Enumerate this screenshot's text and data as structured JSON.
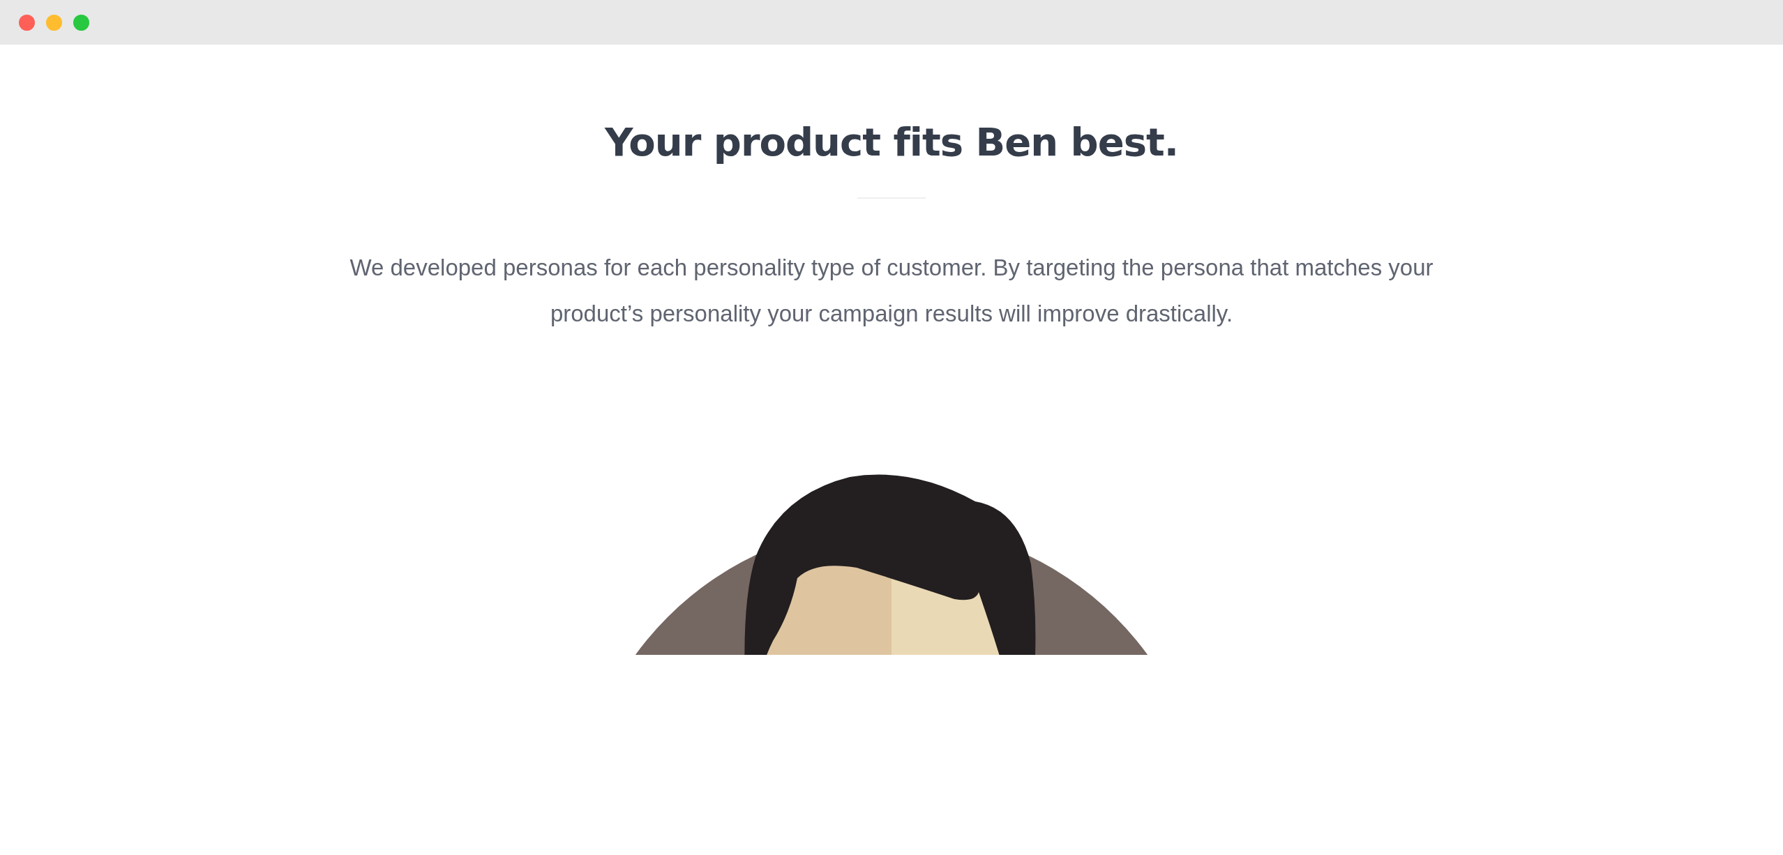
{
  "heading": "Your product fits Ben best.",
  "description": "We developed personas for each personality type of customer. By targeting the persona that matches your product’s personality your campaign results will improve drastically."
}
